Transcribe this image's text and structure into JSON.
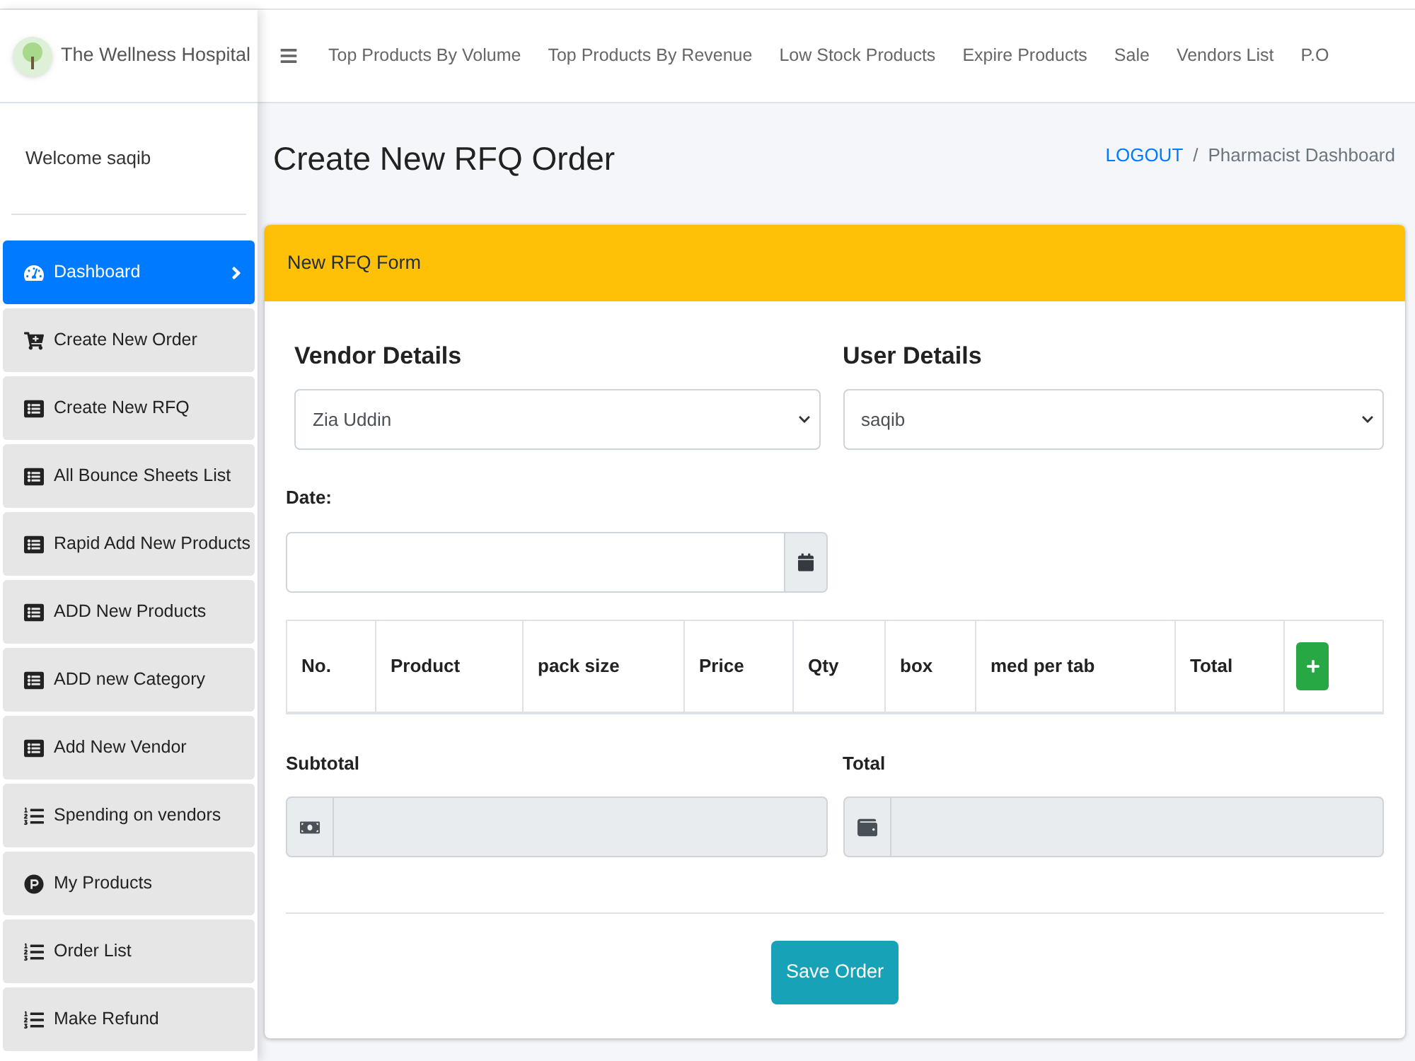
{
  "sidebar": {
    "brand": "The Wellness Hospital",
    "welcome": "Welcome saqib",
    "items": [
      {
        "label": "Dashboard",
        "kind": "dashboard",
        "selected": true,
        "has_submenu": true
      },
      {
        "label": "Create New Order",
        "kind": "cart",
        "selected": false,
        "has_submenu": false
      },
      {
        "label": "Create New RFQ",
        "kind": "form",
        "selected": false,
        "has_submenu": false
      },
      {
        "label": "All Bounce Sheets List",
        "kind": "form",
        "selected": false,
        "has_submenu": false
      },
      {
        "label": "Rapid Add New Products",
        "kind": "form",
        "selected": false,
        "has_submenu": false
      },
      {
        "label": "ADD New Products",
        "kind": "form",
        "selected": false,
        "has_submenu": false
      },
      {
        "label": "ADD new Category",
        "kind": "form",
        "selected": false,
        "has_submenu": false
      },
      {
        "label": "Add New Vendor",
        "kind": "form",
        "selected": false,
        "has_submenu": false
      },
      {
        "label": "Spending on vendors",
        "kind": "ordered",
        "selected": false,
        "has_submenu": false
      },
      {
        "label": "My Products",
        "kind": "badge",
        "selected": false,
        "has_submenu": false
      },
      {
        "label": "Order List",
        "kind": "ordered",
        "selected": false,
        "has_submenu": false
      },
      {
        "label": "Make Refund",
        "kind": "ordered",
        "selected": false,
        "has_submenu": false
      }
    ]
  },
  "top_nav": {
    "links": [
      "Top Products By Volume",
      "Top Products By Revenue",
      "Low Stock Products",
      "Expire Products",
      "Sale",
      "Vendors List",
      "P.O"
    ]
  },
  "page_header": {
    "title": "Create New RFQ Order",
    "separator": "/",
    "breadcrumb": [
      {
        "label": "LOGOUT",
        "kind": "link"
      },
      {
        "label": "Pharmacist Dashboard",
        "kind": "current"
      }
    ]
  },
  "card": {
    "title": "New RFQ Form",
    "vendor": {
      "label": "Vendor Details",
      "value": "Zia Uddin"
    },
    "user": {
      "label": "User Details",
      "value": "saqib"
    },
    "date": {
      "label": "Date:",
      "disabled": false
    },
    "table": {
      "columns": [
        "No.",
        "Product",
        "pack size",
        "Price",
        "Qty",
        "box",
        "med per tab",
        "Total"
      ]
    },
    "subtotal": {
      "label": "Subtotal",
      "disabled": true
    },
    "total": {
      "label": "Total",
      "disabled": true
    },
    "save_button": "Save Order"
  }
}
